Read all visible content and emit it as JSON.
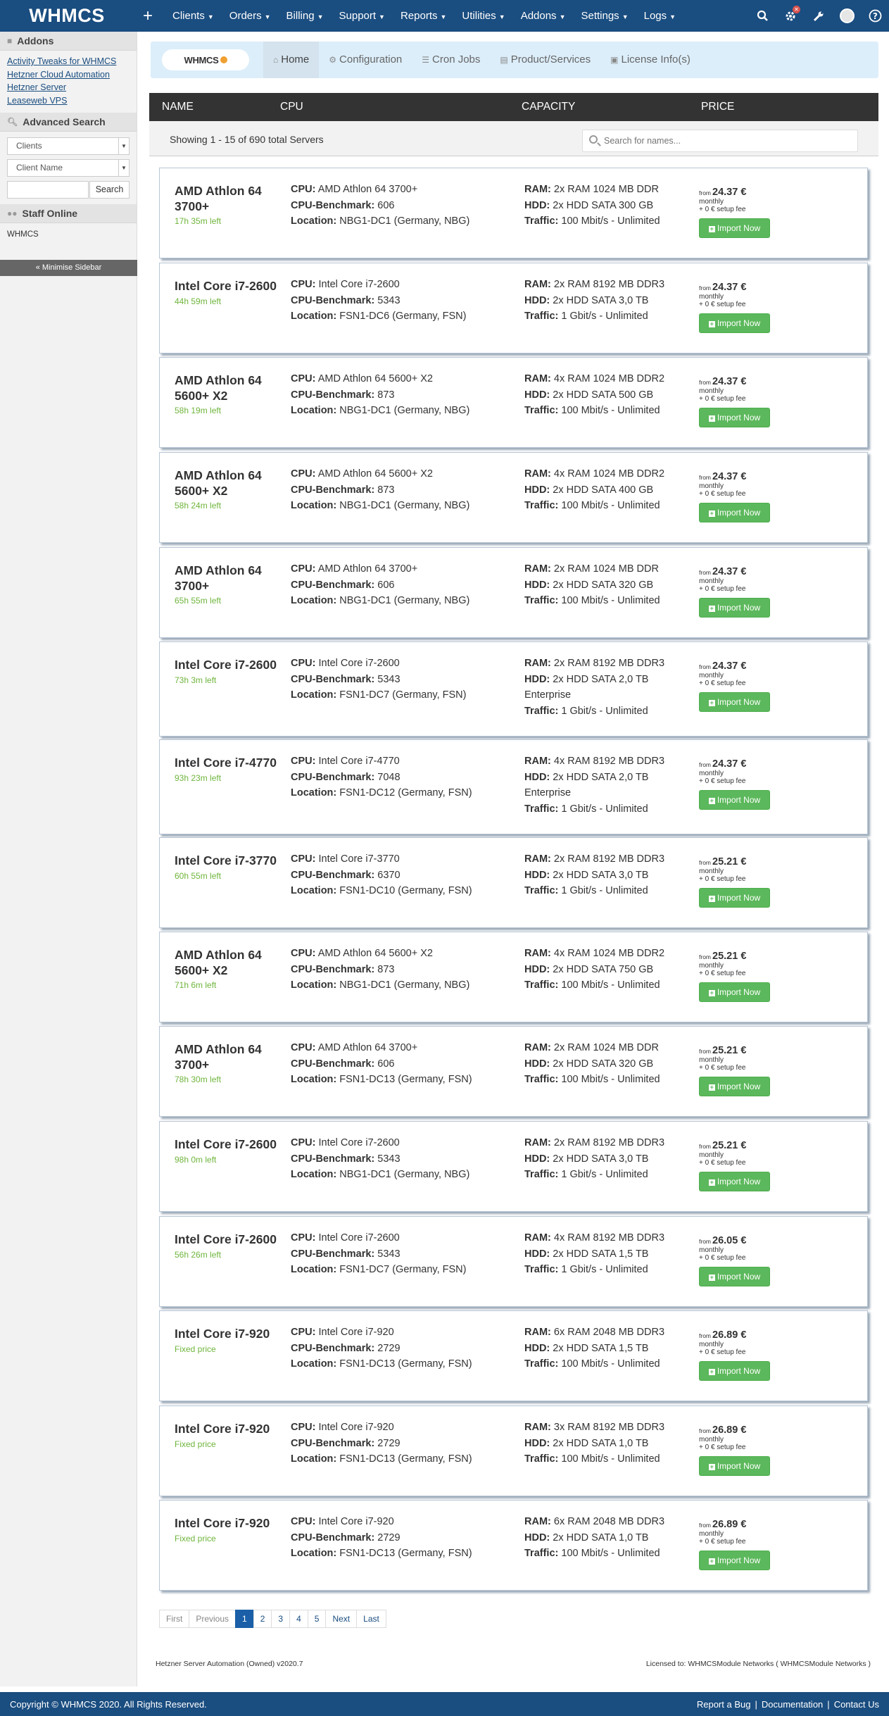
{
  "nav": {
    "logo": "WHMCS",
    "plus": "+",
    "menu": [
      "Clients",
      "Orders",
      "Billing",
      "Support",
      "Reports",
      "Utilities",
      "Addons",
      "Settings",
      "Logs"
    ],
    "badge": "✕"
  },
  "sidebar": {
    "addons_title": "Addons",
    "addons_links": [
      "Activity Tweaks for WHMCS",
      "Hetzner Cloud Automation",
      "Hetzner Server",
      "Leaseweb VPS"
    ],
    "search_title": "Advanced Search",
    "search_type": "Clients",
    "search_field": "Client Name",
    "search_button": "Search",
    "staff_title": "Staff Online",
    "staff_name": "WHMCS",
    "minimise": "« Minimise Sidebar"
  },
  "module": {
    "logo_text": "WHMCS",
    "tabs": [
      "Home",
      "Configuration",
      "Cron Jobs",
      "Product/Services",
      "License Info(s)"
    ]
  },
  "table": {
    "headers": [
      "NAME",
      "CPU",
      "CAPACITY",
      "PRICE"
    ],
    "showing": "Showing 1 - 15 of 690 total Servers",
    "search_placeholder": "Search for names..."
  },
  "labels": {
    "cpu": "CPU:",
    "bench": "CPU-Benchmark:",
    "location": "Location:",
    "ram": "RAM:",
    "hdd": "HDD:",
    "traffic": "Traffic:",
    "from": "from",
    "monthly": "monthly",
    "setup": "+ 0 € setup fee",
    "import": "Import Now"
  },
  "servers": [
    {
      "name": "AMD Athlon 64 3700+",
      "time": "17h 35m left",
      "cpu": "AMD Athlon 64 3700+",
      "bench": "606",
      "location": "NBG1-DC1 (Germany, NBG)",
      "ram": "2x RAM 1024 MB DDR",
      "hdd": "2x HDD SATA 300 GB",
      "traffic": "100 Mbit/s - Unlimited",
      "price": "24.37 €"
    },
    {
      "name": "Intel Core i7-2600",
      "time": "44h 59m left",
      "cpu": "Intel Core i7-2600",
      "bench": "5343",
      "location": "FSN1-DC6 (Germany, FSN)",
      "ram": "2x RAM 8192 MB DDR3",
      "hdd": "2x HDD SATA 3,0 TB",
      "traffic": "1 Gbit/s - Unlimited",
      "price": "24.37 €"
    },
    {
      "name": "AMD Athlon 64 5600+ X2",
      "time": "58h 19m left",
      "cpu": "AMD Athlon 64 5600+ X2",
      "bench": "873",
      "location": "NBG1-DC1 (Germany, NBG)",
      "ram": "4x RAM 1024 MB DDR2",
      "hdd": "2x HDD SATA 500 GB",
      "traffic": "100 Mbit/s - Unlimited",
      "price": "24.37 €"
    },
    {
      "name": "AMD Athlon 64 5600+ X2",
      "time": "58h 24m left",
      "cpu": "AMD Athlon 64 5600+ X2",
      "bench": "873",
      "location": "NBG1-DC1 (Germany, NBG)",
      "ram": "4x RAM 1024 MB DDR2",
      "hdd": "2x HDD SATA 400 GB",
      "traffic": "100 Mbit/s - Unlimited",
      "price": "24.37 €"
    },
    {
      "name": "AMD Athlon 64 3700+",
      "time": "65h 55m left",
      "cpu": "AMD Athlon 64 3700+",
      "bench": "606",
      "location": "NBG1-DC1 (Germany, NBG)",
      "ram": "2x RAM 1024 MB DDR",
      "hdd": "2x HDD SATA 320 GB",
      "traffic": "100 Mbit/s - Unlimited",
      "price": "24.37 €"
    },
    {
      "name": "Intel Core i7-2600",
      "time": "73h 3m left",
      "cpu": "Intel Core i7-2600",
      "bench": "5343",
      "location": "FSN1-DC7 (Germany, FSN)",
      "ram": "2x RAM 8192 MB DDR3",
      "hdd": "2x HDD SATA 2,0 TB Enterprise",
      "traffic": "1 Gbit/s - Unlimited",
      "price": "24.37 €"
    },
    {
      "name": "Intel Core i7-4770",
      "time": "93h 23m left",
      "cpu": "Intel Core i7-4770",
      "bench": "7048",
      "location": "FSN1-DC12 (Germany, FSN)",
      "ram": "4x RAM 8192 MB DDR3",
      "hdd": "2x HDD SATA 2,0 TB Enterprise",
      "traffic": "1 Gbit/s - Unlimited",
      "price": "24.37 €"
    },
    {
      "name": "Intel Core i7-3770",
      "time": "60h 55m left",
      "cpu": "Intel Core i7-3770",
      "bench": "6370",
      "location": "FSN1-DC10 (Germany, FSN)",
      "ram": "2x RAM 8192 MB DDR3",
      "hdd": "2x HDD SATA 3,0 TB",
      "traffic": "1 Gbit/s - Unlimited",
      "price": "25.21 €"
    },
    {
      "name": "AMD Athlon 64 5600+ X2",
      "time": "71h 6m left",
      "cpu": "AMD Athlon 64 5600+ X2",
      "bench": "873",
      "location": "NBG1-DC1 (Germany, NBG)",
      "ram": "4x RAM 1024 MB DDR2",
      "hdd": "2x HDD SATA 750 GB",
      "traffic": "100 Mbit/s - Unlimited",
      "price": "25.21 €"
    },
    {
      "name": "AMD Athlon 64 3700+",
      "time": "78h 30m left",
      "cpu": "AMD Athlon 64 3700+",
      "bench": "606",
      "location": "FSN1-DC13 (Germany, FSN)",
      "ram": "2x RAM 1024 MB DDR",
      "hdd": "2x HDD SATA 320 GB",
      "traffic": "100 Mbit/s - Unlimited",
      "price": "25.21 €"
    },
    {
      "name": "Intel Core i7-2600",
      "time": "98h 0m left",
      "cpu": "Intel Core i7-2600",
      "bench": "5343",
      "location": "NBG1-DC1 (Germany, NBG)",
      "ram": "2x RAM 8192 MB DDR3",
      "hdd": "2x HDD SATA 3,0 TB",
      "traffic": "1 Gbit/s - Unlimited",
      "price": "25.21 €"
    },
    {
      "name": "Intel Core i7-2600",
      "time": "56h 26m left",
      "cpu": "Intel Core i7-2600",
      "bench": "5343",
      "location": "FSN1-DC7 (Germany, FSN)",
      "ram": "4x RAM 8192 MB DDR3",
      "hdd": "2x HDD SATA 1,5 TB",
      "traffic": "1 Gbit/s - Unlimited",
      "price": "26.05 €"
    },
    {
      "name": "Intel Core i7-920",
      "time": "Fixed price",
      "cpu": "Intel Core i7-920",
      "bench": "2729",
      "location": "FSN1-DC13 (Germany, FSN)",
      "ram": "6x RAM 2048 MB DDR3",
      "hdd": "2x HDD SATA 1,5 TB",
      "traffic": "100 Mbit/s - Unlimited",
      "price": "26.89 €"
    },
    {
      "name": "Intel Core i7-920",
      "time": "Fixed price",
      "cpu": "Intel Core i7-920",
      "bench": "2729",
      "location": "FSN1-DC13 (Germany, FSN)",
      "ram": "3x RAM 8192 MB DDR3",
      "hdd": "2x HDD SATA 1,0 TB",
      "traffic": "100 Mbit/s - Unlimited",
      "price": "26.89 €"
    },
    {
      "name": "Intel Core i7-920",
      "time": "Fixed price",
      "cpu": "Intel Core i7-920",
      "bench": "2729",
      "location": "FSN1-DC13 (Germany, FSN)",
      "ram": "6x RAM 2048 MB DDR3",
      "hdd": "2x HDD SATA 1,0 TB",
      "traffic": "100 Mbit/s - Unlimited",
      "price": "26.89 €"
    }
  ],
  "pagination": [
    "First",
    "Previous",
    "1",
    "2",
    "3",
    "4",
    "5",
    "Next",
    "Last"
  ],
  "footer": {
    "left": "Hetzner Server Automation (Owned) v2020.7",
    "right": "Licensed to: WHMCSModule Networks ( WHMCSModule Networks )",
    "copyright": "Copyright © WHMCS 2020. All Rights Reserved.",
    "links": [
      "Report a Bug",
      "Documentation",
      "Contact Us"
    ]
  }
}
